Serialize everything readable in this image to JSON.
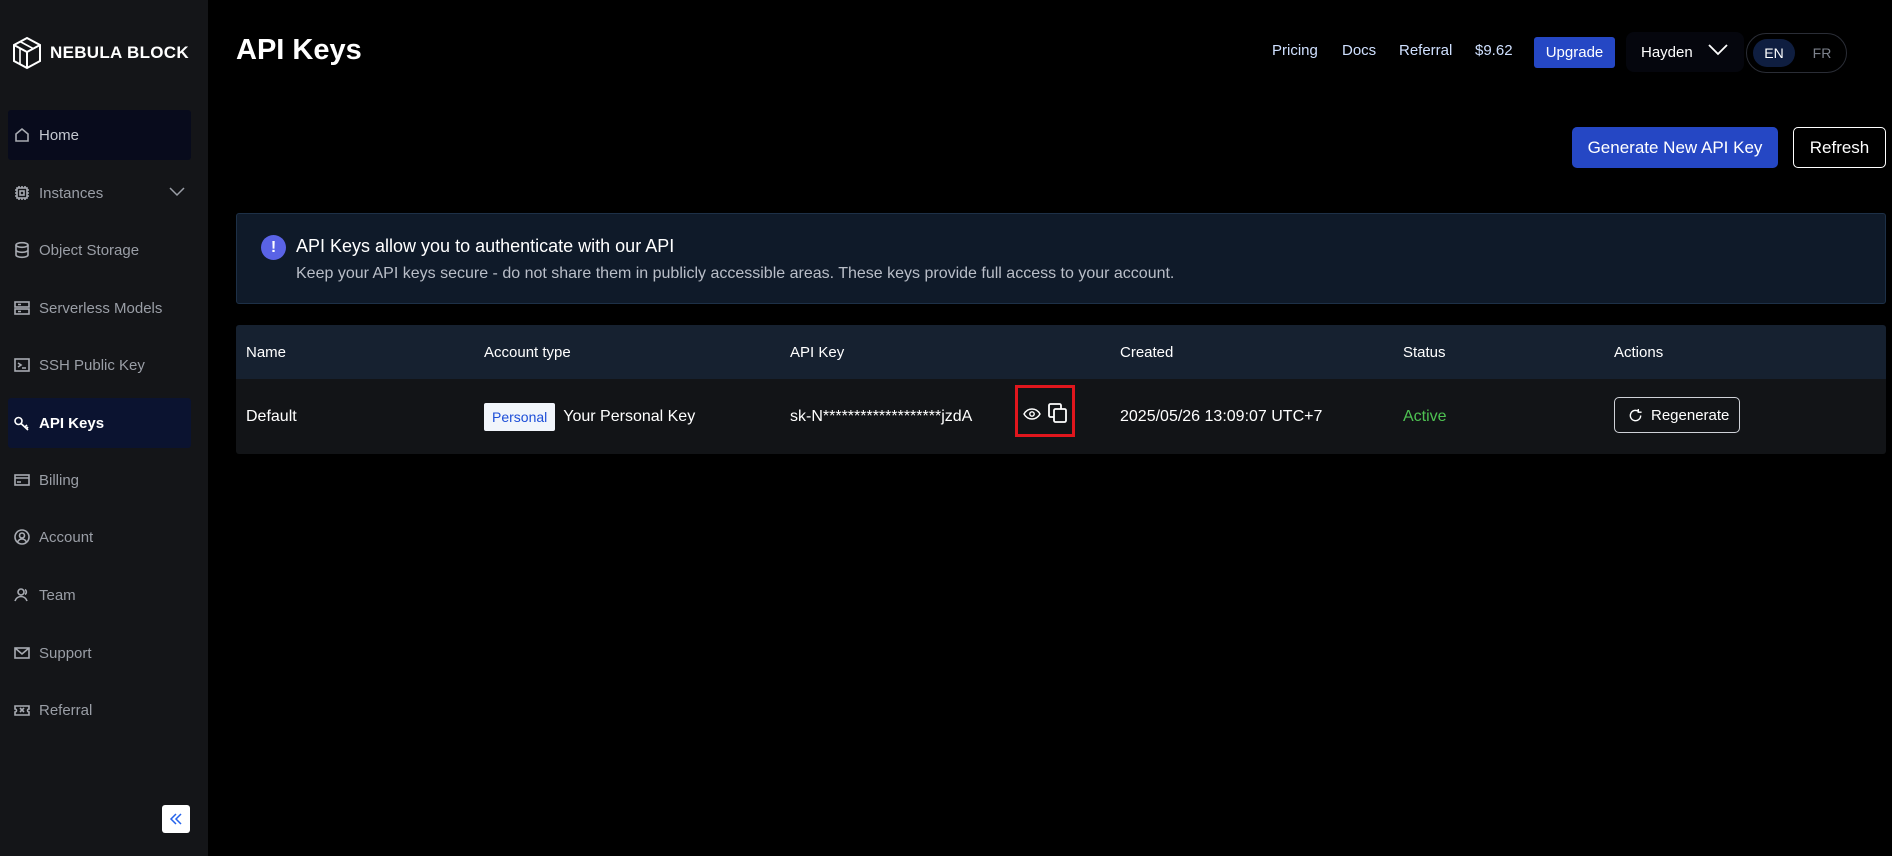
{
  "brand": {
    "name": "NEBULA BLOCK"
  },
  "sidebar": {
    "items": [
      {
        "label": "Home",
        "icon": "home-icon"
      },
      {
        "label": "Instances",
        "icon": "chip-icon"
      },
      {
        "label": "Object Storage",
        "icon": "database-icon"
      },
      {
        "label": "Serverless Models",
        "icon": "server-icon"
      },
      {
        "label": "SSH Public Key",
        "icon": "terminal-icon"
      },
      {
        "label": "API Keys",
        "icon": "key-icon"
      },
      {
        "label": "Billing",
        "icon": "card-icon"
      },
      {
        "label": "Account",
        "icon": "user-circle-icon"
      },
      {
        "label": "Team",
        "icon": "team-icon"
      },
      {
        "label": "Support",
        "icon": "mail-icon"
      },
      {
        "label": "Referral",
        "icon": "ticket-icon"
      }
    ],
    "active": "API Keys"
  },
  "header": {
    "title": "API Keys",
    "links": {
      "pricing": "Pricing",
      "docs": "Docs",
      "referral": "Referral"
    },
    "balance": "$9.62",
    "upgrade_label": "Upgrade",
    "user_name": "Hayden",
    "languages": [
      "EN",
      "FR"
    ],
    "selected_language": "EN"
  },
  "actions": {
    "generate_label": "Generate New API Key",
    "refresh_label": "Refresh"
  },
  "banner": {
    "title": "API Keys allow you to authenticate with our API",
    "text": "Keep your API keys secure - do not share them in publicly accessible areas. These keys provide full access to your account.",
    "icon_glyph": "!"
  },
  "table": {
    "headers": [
      "Name",
      "Account type",
      "API Key",
      "Created",
      "Status",
      "Actions"
    ],
    "rows": [
      {
        "name": "Default",
        "account_badge": "Personal",
        "account_type": "Your Personal Key",
        "api_key": "sk-N*******************jzdA",
        "created": "2025/05/26 13:09:07 UTC+7",
        "status": "Active",
        "action_label": "Regenerate"
      }
    ]
  },
  "colors": {
    "accent": "#2547c4",
    "status_active": "#4ec252",
    "highlight": "#e0161d"
  }
}
